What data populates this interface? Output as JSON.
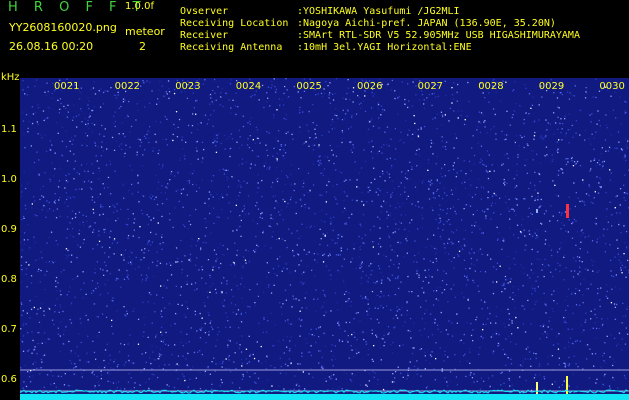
{
  "header": {
    "brand": "H R O F F T",
    "version": "1.0.0f",
    "filename": "YY2608160020.png",
    "datetime": "26.08.16 00:20",
    "meteor_label": "meteor",
    "meteor_count": "2"
  },
  "info": {
    "observer_label": "Ovserver",
    "observer_value": ":YOSHIKAWA Yasufumi /JG2MLI",
    "location_label": "Receiving Location",
    "location_value": ":Nagoya Aichi-pref. JAPAN (136.90E, 35.20N)",
    "receiver_label": "Receiver",
    "receiver_value": ":SMArt RTL-SDR V5 52.905MHz USB HIGASHIMURAYAMA",
    "antenna_label": "Receiving Antenna",
    "antenna_value": ":10mH 3el.YAGI Horizontal:ENE"
  },
  "axes": {
    "y_unit": "kHz",
    "y_ticks": [
      "1.1",
      "1.0",
      "0.9",
      "0.8",
      "0.7",
      "0.6"
    ],
    "x_ticks": [
      "0021",
      "0022",
      "0023",
      "0024",
      "0025",
      "0026",
      "0027",
      "0028",
      "0029",
      "0030"
    ]
  },
  "colors": {
    "background": "#000000",
    "label_yellow": "#ffff20",
    "label_green": "#3ed63e",
    "noise_blue": "#16229a",
    "baseline_cyan": "#12e6f6"
  },
  "meteors": [
    {
      "minute": "0029",
      "freq_khz": 0.93,
      "label": "meteor"
    },
    {
      "minute": "0029",
      "freq_khz": 0.94,
      "label": "meteor"
    }
  ]
}
